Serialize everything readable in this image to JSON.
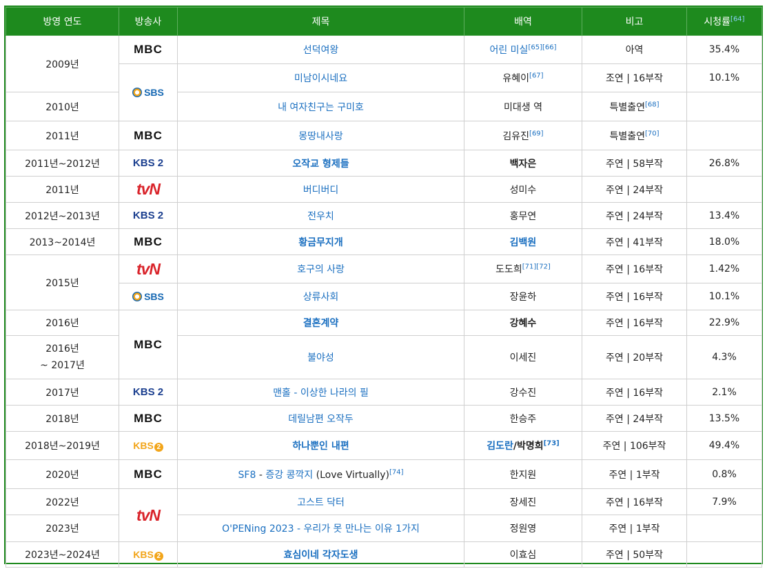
{
  "headers": {
    "year": "방영 연도",
    "broadcaster": "방송사",
    "title": "제목",
    "role": "배역",
    "note": "비고",
    "rating": "시청률",
    "rating_ref": "[64]"
  },
  "rows": [
    {
      "year": "2009년",
      "title": "선덕여왕",
      "role": "어린 미실",
      "role_ref": "[65][66]",
      "note": "아역",
      "rating": "35.4%"
    },
    {
      "title": "미남이시네요",
      "role": "유혜이",
      "role_ref": "[67]",
      "note": "조연 | 16부작",
      "rating": "10.1%"
    },
    {
      "year": "2010년",
      "title": "내 여자친구는 구미호",
      "role": "미대생 역",
      "note": "특별출연",
      "note_ref": "[68]",
      "rating": ""
    },
    {
      "year": "2011년",
      "title": "몽땅내사랑",
      "role": "김유진",
      "role_ref": "[69]",
      "note": "특별출연",
      "note_ref": "[70]",
      "rating": ""
    },
    {
      "year": "2011년~2012년",
      "title": "오작교 형제들",
      "role": "백자은",
      "note": "주연 | 58부작",
      "rating": "26.8%"
    },
    {
      "year": "2011년",
      "title": "버디버디",
      "role": "성미수",
      "note": "주연 | 24부작",
      "rating": ""
    },
    {
      "year": "2012년~2013년",
      "title": "전우치",
      "role": "홍무연",
      "note": "주연 | 24부작",
      "rating": "13.4%"
    },
    {
      "year": "2013~2014년",
      "title": "황금무지개",
      "role": "김백원",
      "note": "주연 | 41부작",
      "rating": "18.0%"
    },
    {
      "year": "2015년",
      "title": "호구의 사랑",
      "role": "도도희",
      "role_ref": "[71][72]",
      "note": "주연 | 16부작",
      "rating": "1.42%"
    },
    {
      "title": "상류사회",
      "role": "장윤하",
      "note": "주연 | 16부작",
      "rating": "10.1%"
    },
    {
      "year": "2016년",
      "title": "결혼계약",
      "role": "강혜수",
      "note": "주연 | 16부작",
      "rating": "22.9%"
    },
    {
      "year_line1": "2016년",
      "year_line2": "~ 2017년",
      "title": "불야성",
      "role": "이세진",
      "note": "주연 | 20부작",
      "rating": "4.3%"
    },
    {
      "year": "2017년",
      "title": "맨홀 - 이상한 나라의 필",
      "role": "강수진",
      "note": "주연 | 16부작",
      "rating": "2.1%"
    },
    {
      "year": "2018년",
      "title": "데릴남편 오작두",
      "role": "한승주",
      "note": "주연 | 24부작",
      "rating": "13.5%"
    },
    {
      "year": "2018년~2019년",
      "title": "하나뿐인 내편",
      "role": "김도란",
      "role_suffix": "/박명희",
      "role_ref": "[73]",
      "note": "주연 | 106부작",
      "rating": "49.4%"
    },
    {
      "year": "2020년",
      "title_link": "SF8",
      "title_dash": " - ",
      "title_link2": "증강 콩깍지",
      "title_plain": " (Love Virtually)",
      "title_ref": "[74]",
      "role": "한지원",
      "note": "주연 | 1부작",
      "rating": "0.8%"
    },
    {
      "year": "2022년",
      "title": "고스트 닥터",
      "role": "장세진",
      "note": "주연 | 16부작",
      "rating": "7.9%"
    },
    {
      "year": "2023년",
      "title": "O'PENing 2023 - 우리가 못 만나는 이유 1가지",
      "role": "정원영",
      "note": "주연 | 1부작",
      "rating": ""
    },
    {
      "year": "2023년~2024년",
      "title": "효심이네 각자도생",
      "role": "이효심",
      "note": "주연 | 50부작",
      "rating": ""
    }
  ],
  "logos": {
    "mbc": "MBC",
    "sbs": "SBS",
    "kbs2": "KBS 2",
    "tvn_t": "tv",
    "tvn_n": "N",
    "kbsk": "KBS",
    "kbsk_num": "2"
  },
  "colors": {
    "header_bg": "#1e8a1e",
    "link": "#1a6fc0",
    "border": "#cfcfcf"
  }
}
